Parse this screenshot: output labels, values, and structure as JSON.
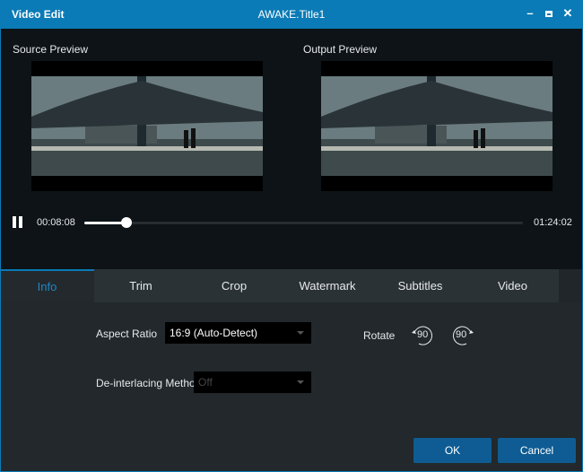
{
  "window": {
    "app_title": "Video Edit",
    "document_title": "AWAKE.Title1"
  },
  "preview": {
    "source_label": "Source Preview",
    "output_label": "Output Preview"
  },
  "playback": {
    "current_time": "00:08:08",
    "total_time": "01:24:02",
    "progress_percent": 9.7,
    "state": "playing"
  },
  "tabs": [
    {
      "label": "Info",
      "active": true
    },
    {
      "label": "Trim"
    },
    {
      "label": "Crop"
    },
    {
      "label": "Watermark"
    },
    {
      "label": "Subtitles"
    },
    {
      "label": "Video"
    }
  ],
  "info": {
    "aspect_ratio_label": "Aspect Ratio",
    "aspect_ratio_value": "16:9 (Auto-Detect)",
    "deinterlace_label": "De-interlacing Method",
    "deinterlace_value": "Off",
    "rotate_label": "Rotate",
    "rotate_left": "90",
    "rotate_right": "90"
  },
  "footer": {
    "ok": "OK",
    "cancel": "Cancel"
  },
  "colors": {
    "accent": "#0a7bb6",
    "button": "#0e5c93"
  }
}
